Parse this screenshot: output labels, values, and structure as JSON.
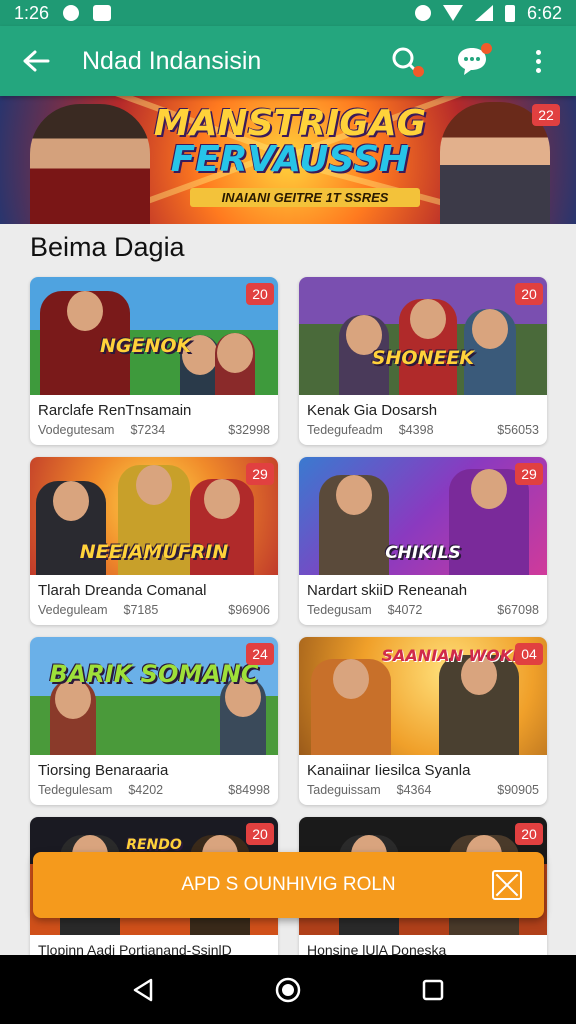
{
  "status_bar": {
    "time_left": "1:26",
    "time_right": "6:62"
  },
  "app_bar": {
    "title": "Ndad Indansisin",
    "back_icon": "arrow-left-icon",
    "search_icon": "search-icon",
    "chat_icon": "chat-bubble-icon",
    "more_icon": "more-vert-icon",
    "accent_color": "#24a67e",
    "notification_color": "#f25a2a"
  },
  "banner": {
    "title_line1": "MANSTRIGAG",
    "title_line2": "FERVAUSSH",
    "subtitle": "INAIANI GEITRE 1T SSRES",
    "badge": "22"
  },
  "section": {
    "title": "Beima Dagia"
  },
  "cards": [
    {
      "badge": "20",
      "art_title": "NGENOK",
      "name": "Rarclafe RenTnsamain",
      "seller": "Vodegutesam",
      "price": "$7234",
      "total": "$32998"
    },
    {
      "badge": "20",
      "art_title": "SHONEEK",
      "name": "Kenak Gia Dosarsh",
      "seller": "Tedegufeadm",
      "price": "$4398",
      "total": "$56053"
    },
    {
      "badge": "29",
      "art_title": "NEEIAMUFRIN",
      "name": "Tlarah Dreanda Comanal",
      "seller": "Vedeguleam",
      "price": "$7185",
      "total": "$96906"
    },
    {
      "badge": "29",
      "art_title": "CHIKILS",
      "name": "Nardart skiiD Reneanah",
      "seller": "Tedegusam",
      "price": "$4072",
      "total": "$67098"
    },
    {
      "badge": "24",
      "art_title": "BARIK SOMANC",
      "name": "Tiorsing Benaraaria",
      "seller": "Tedegulesam",
      "price": "$4202",
      "total": "$84998"
    },
    {
      "badge": "04",
      "art_title": "SAANIAN WOKR",
      "name": "Kanaiinar Iiesilca Syanla",
      "seller": "Tadeguissam",
      "price": "$4364",
      "total": "$90905"
    },
    {
      "badge": "20",
      "art_title": "RENDO",
      "name": "Tlopinn Aadi Portianand-SsinlD",
      "seller": "",
      "price": "",
      "total": ""
    },
    {
      "badge": "20",
      "art_title": "",
      "name": "Honsine lUlA Doneska",
      "seller": "",
      "price": "",
      "total": ""
    }
  ],
  "action_bar": {
    "label": "APD  S OUNHIVIG ROLN",
    "icon": "close-box-icon",
    "color": "#f59a1c"
  },
  "nav_bar": {
    "back_icon": "triangle-back-icon",
    "home_icon": "circle-home-icon",
    "recents_icon": "square-recents-icon"
  }
}
